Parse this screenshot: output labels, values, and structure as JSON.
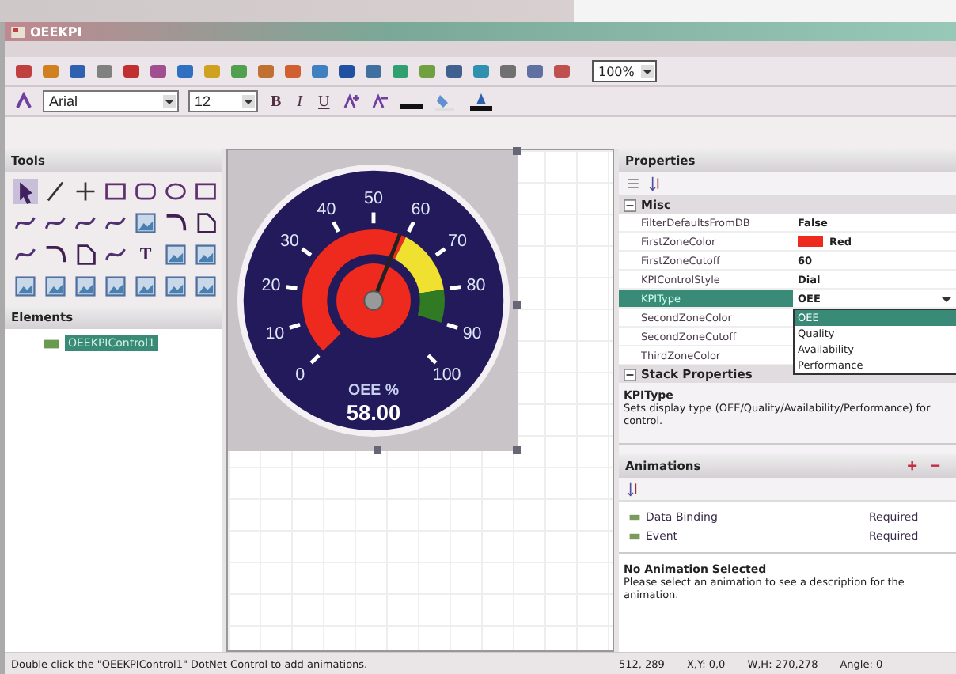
{
  "window": {
    "title": "OEEKPI"
  },
  "toolbar": {
    "zoom": "100%"
  },
  "format_bar": {
    "font": "Arial",
    "size": "12",
    "bold": "B",
    "italic": "I",
    "underline": "U"
  },
  "tools": {
    "title": "Tools",
    "items": [
      {
        "kind": "pointer",
        "selected": true
      },
      {
        "kind": "line",
        "selected": false
      },
      {
        "kind": "cross",
        "selected": false
      },
      {
        "kind": "rect",
        "selected": false
      },
      {
        "kind": "round",
        "selected": false
      },
      {
        "kind": "ellipse",
        "selected": false
      },
      {
        "kind": "rect",
        "selected": false
      },
      {
        "kind": "curve",
        "selected": false
      },
      {
        "kind": "curve",
        "selected": false
      },
      {
        "kind": "curve",
        "selected": false
      },
      {
        "kind": "curve",
        "selected": false
      },
      {
        "kind": "image",
        "selected": false
      },
      {
        "kind": "arc",
        "selected": false
      },
      {
        "kind": "doc",
        "selected": false
      },
      {
        "kind": "curve",
        "selected": false
      },
      {
        "kind": "arc",
        "selected": false
      },
      {
        "kind": "doc",
        "selected": false
      },
      {
        "kind": "curve",
        "selected": false
      },
      {
        "kind": "text",
        "label": "T",
        "selected": false
      },
      {
        "kind": "image",
        "selected": false
      },
      {
        "kind": "image",
        "selected": false
      },
      {
        "kind": "image",
        "selected": false
      },
      {
        "kind": "image",
        "selected": false
      },
      {
        "kind": "image",
        "selected": false
      },
      {
        "kind": "image",
        "selected": false
      },
      {
        "kind": "image",
        "selected": false
      },
      {
        "kind": "image",
        "selected": false
      },
      {
        "kind": "image",
        "selected": false
      }
    ]
  },
  "elements": {
    "title": "Elements",
    "items": [
      {
        "label": "OEEKPIControl1",
        "selected": true
      }
    ]
  },
  "gauge": {
    "ticks": [
      "0",
      "10",
      "20",
      "30",
      "40",
      "50",
      "60",
      "70",
      "80",
      "90",
      "100"
    ],
    "caption": "OEE %",
    "reading": "58.00",
    "level": 0.58
  },
  "properties": {
    "title": "Properties",
    "rows": [
      {
        "kind": "category",
        "name": "Misc",
        "expanded": true
      },
      {
        "kind": "prop",
        "name": "FilterDefaultsFromDB",
        "value": "False",
        "selected": false
      },
      {
        "kind": "prop",
        "name": "FirstZoneColor",
        "value": "Red",
        "color": "#ee2a1e",
        "selected": false
      },
      {
        "kind": "prop",
        "name": "FirstZoneCutoff",
        "value": "60",
        "selected": false
      },
      {
        "kind": "prop",
        "name": "KPIControlStyle",
        "value": "Dial",
        "selected": false
      },
      {
        "kind": "prop",
        "name": "KPIType",
        "value": "OEE",
        "selected": true
      },
      {
        "kind": "prop",
        "name": "SecondZoneColor",
        "selected": false
      },
      {
        "kind": "prop",
        "name": "SecondZoneCutoff",
        "selected": false
      },
      {
        "kind": "prop",
        "name": "ThirdZoneColor",
        "selected": false
      },
      {
        "kind": "category",
        "name": "Stack Properties",
        "expanded": true
      }
    ],
    "dropdown": [
      {
        "label": "OEE",
        "selected": true
      },
      {
        "label": "Quality",
        "selected": false
      },
      {
        "label": "Availability",
        "selected": false
      },
      {
        "label": "Performance",
        "selected": false
      }
    ],
    "description_title": "KPIType",
    "description": "Sets display type (OEE/Quality/Availability/Performance) for control."
  },
  "animations": {
    "title": "Animations",
    "add": "+",
    "remove": "−",
    "rows": [
      {
        "name": "Data Binding",
        "value": "Required"
      },
      {
        "name": "Event",
        "value": "Required"
      }
    ],
    "info_title": "No Animation Selected",
    "info": "Please select an animation to see a description for the animation."
  },
  "status_bar": {
    "message": "Double click the \"OEEKPIControl1\" DotNet Control to add animations.",
    "position": "512, 289",
    "xy": "X,Y: 0,0",
    "wh": "W,H: 270,278",
    "angle": "Angle: 0"
  }
}
